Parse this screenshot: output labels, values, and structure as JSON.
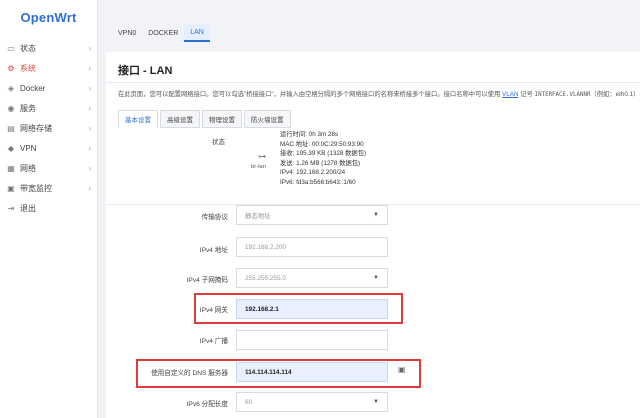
{
  "sidebar": {
    "logo": "OpenWrt",
    "items": [
      {
        "label": "状态",
        "icon": "monitor-icon",
        "glyph": "▭"
      },
      {
        "label": "系统",
        "icon": "gear-icon",
        "glyph": "⚙"
      },
      {
        "label": "Docker",
        "icon": "docker-icon",
        "glyph": "◈"
      },
      {
        "label": "服务",
        "icon": "services-icon",
        "glyph": "◉"
      },
      {
        "label": "网络存储",
        "icon": "storage-icon",
        "glyph": "▤"
      },
      {
        "label": "VPN",
        "icon": "shield-icon",
        "glyph": "◆"
      },
      {
        "label": "网络",
        "icon": "network-icon",
        "glyph": "▦"
      },
      {
        "label": "带宽监控",
        "icon": "chart-icon",
        "glyph": "▣"
      },
      {
        "label": "退出",
        "icon": "logout-icon",
        "glyph": "⇥"
      }
    ],
    "active_index": 1
  },
  "top_tabs": [
    {
      "label": "VPN0"
    },
    {
      "label": "DOCKER"
    },
    {
      "label": "LAN"
    }
  ],
  "page": {
    "title": "接口 - LAN",
    "desc_prefix": "在此页面，您可以配置网络接口。您可以勾选\"桥接接口\"，并输入由空格分隔的多个网络接口的名称来桥接多个接口。接口名称中可以使用 ",
    "desc_link": "VLAN",
    "desc_mid": " 记号 ",
    "desc_mono": "INTERFACE.VLANNR",
    "desc_suffix": "（例如：eth0.1）"
  },
  "sub_tabs": [
    {
      "label": "基本设置"
    },
    {
      "label": "高级设置"
    },
    {
      "label": "物理设置"
    },
    {
      "label": "防火墙设置"
    }
  ],
  "status": {
    "label": "状态",
    "iface": "br-lan",
    "lines": [
      "运行时间: 0h 3m 28s",
      "MAC 地址: 00:0C:29:50:93:90",
      "接收: 195.39 KB (1328 数据包)",
      "发送: 1.26 MB (1278 数据包)",
      "IPv4: 192.168.2.200/24",
      "IPv6: fd3a:b566:b643::1/60"
    ]
  },
  "form": {
    "protocol": {
      "label": "传输协议",
      "value": "静态地址"
    },
    "ipv4_addr": {
      "label": "IPv4 地址",
      "value": "192.168.2.200"
    },
    "netmask": {
      "label": "IPv4 子网掩码",
      "value": "255.255.255.0"
    },
    "gateway": {
      "label": "IPv4 网关",
      "value": "192.168.2.1"
    },
    "broadcast": {
      "label": "IPv4 广播",
      "value": ""
    },
    "dns": {
      "label": "使用自定义的 DNS 服务器",
      "value": "114.114.114.114"
    },
    "ipv6_len": {
      "label": "IPv6 分配长度",
      "value": "60"
    }
  }
}
